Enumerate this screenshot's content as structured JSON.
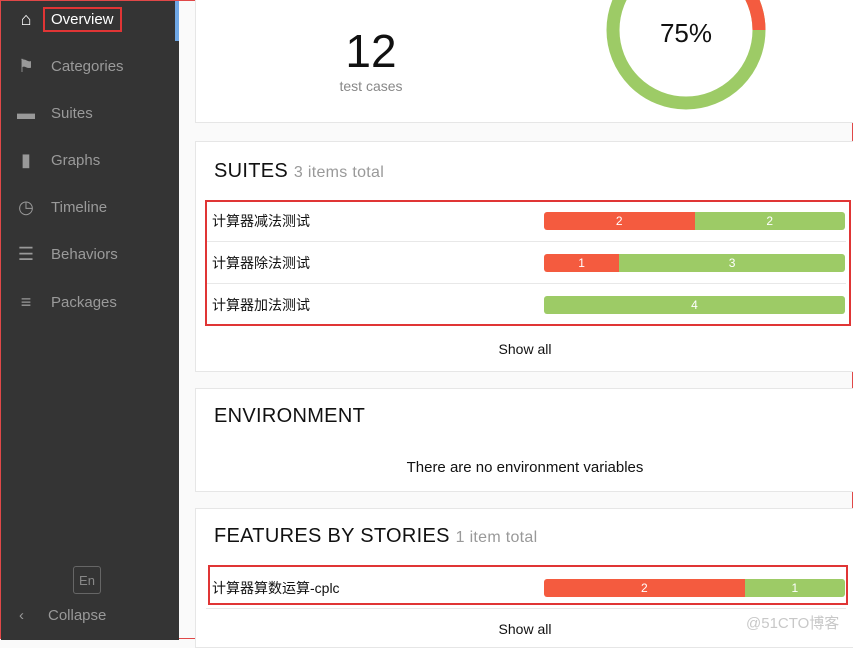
{
  "sidebar": {
    "items": [
      {
        "label": "Overview",
        "icon": "home-icon"
      },
      {
        "label": "Categories",
        "icon": "flag-icon"
      },
      {
        "label": "Suites",
        "icon": "briefcase-icon"
      },
      {
        "label": "Graphs",
        "icon": "bar-chart-icon"
      },
      {
        "label": "Timeline",
        "icon": "clock-icon"
      },
      {
        "label": "Behaviors",
        "icon": "list-icon"
      },
      {
        "label": "Packages",
        "icon": "packages-icon"
      }
    ],
    "language": "En",
    "collapse": "Collapse"
  },
  "summary": {
    "count": "12",
    "count_label": "test cases",
    "percent": "75%",
    "pass_fraction": 0.75
  },
  "suites": {
    "title": "SUITES",
    "subtitle": "3 items total",
    "rows": [
      {
        "name": "计算器减法测试",
        "failed": 2,
        "passed": 2
      },
      {
        "name": "计算器除法测试",
        "failed": 1,
        "passed": 3
      },
      {
        "name": "计算器加法测试",
        "failed": 0,
        "passed": 4
      }
    ],
    "show_all": "Show all"
  },
  "environment": {
    "title": "ENVIRONMENT",
    "empty": "There are no environment variables"
  },
  "features": {
    "title": "FEATURES BY STORIES",
    "subtitle": "1 item total",
    "rows": [
      {
        "name": "计算器算数运算-cplc",
        "failed": 2,
        "passed": 1
      }
    ],
    "show_all": "Show all"
  },
  "watermark": "@51CTO博客",
  "colors": {
    "failed": "#f45b3f",
    "passed": "#9dcb66",
    "sidebar": "#343434"
  }
}
